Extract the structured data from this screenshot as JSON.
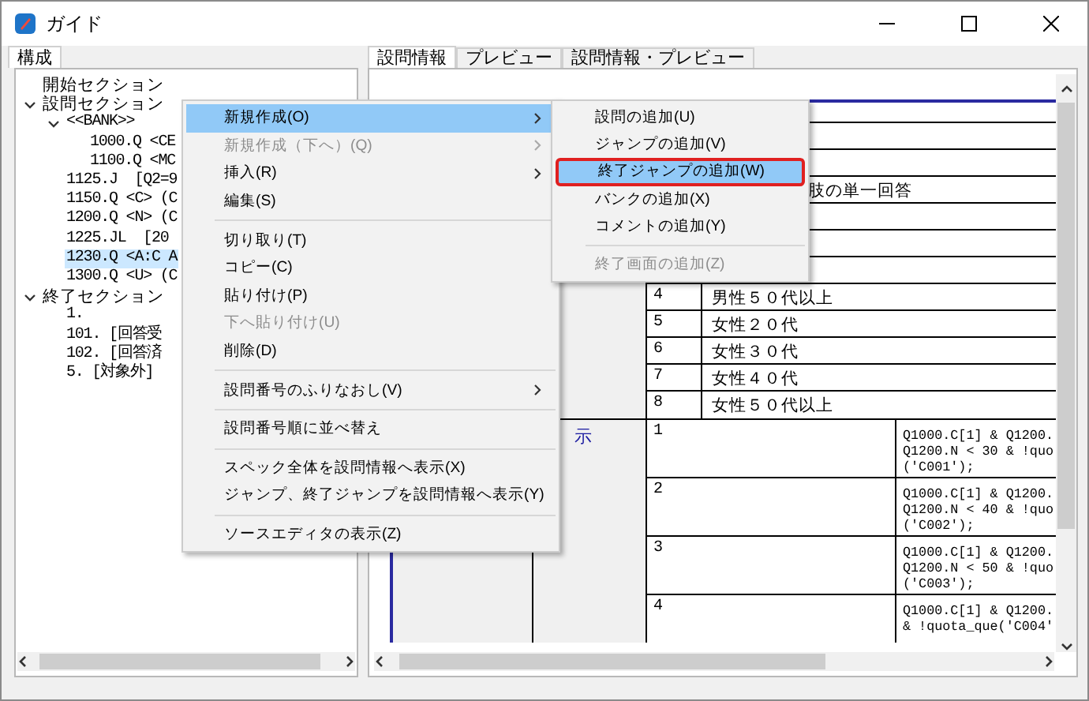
{
  "window": {
    "title": "ガイド"
  },
  "left_tabs": [
    {
      "label": "構成",
      "selected": true
    }
  ],
  "tree": [
    {
      "label": "開始セクション",
      "selected": false
    },
    {
      "label": "設問セクション",
      "expanded": true,
      "selected": false,
      "children": [
        {
          "label": "<<BANK>>",
          "expanded": true,
          "selected": false,
          "children": [
            {
              "label": "1000.Q <CE",
              "selected": false
            },
            {
              "label": "1100.Q <MC",
              "selected": false
            }
          ]
        },
        {
          "label": "1125.J  [Q2=9",
          "selected": false
        },
        {
          "label": "1150.Q <C> (C",
          "selected": false
        },
        {
          "label": "1200.Q <N> (C",
          "selected": false
        },
        {
          "label": "1225.JL  [20",
          "selected": false
        },
        {
          "label": "1230.Q <A:C A",
          "selected": true
        },
        {
          "label": "1300.Q <U> (C",
          "selected": false
        }
      ]
    },
    {
      "label": "終了セクション",
      "expanded": true,
      "selected": false,
      "children": [
        {
          "label": "1.",
          "selected": false
        },
        {
          "label": "101. [回答受",
          "selected": false
        },
        {
          "label": "102. [回答済",
          "selected": false
        },
        {
          "label": "5. [対象外]",
          "selected": false
        }
      ]
    }
  ],
  "right_tabs": [
    {
      "label": "設問情報",
      "selected": true
    },
    {
      "label": "プレビュー",
      "selected": false
    },
    {
      "label": "設問情報・プレビュー",
      "selected": false
    }
  ],
  "question_table": {
    "description_fragment": "肢の単一回答",
    "choices": [
      {
        "number": "4",
        "text": "男性５０代以上"
      },
      {
        "number": "5",
        "text": "女性２０代"
      },
      {
        "number": "6",
        "text": "女性３０代"
      },
      {
        "number": "7",
        "text": "女性４０代"
      },
      {
        "number": "8",
        "text": "女性５０代以上"
      }
    ],
    "condition_label": "示",
    "conditions": [
      {
        "number": "1",
        "code": "Q1000.C[1] & Q1200.\nQ1200.N < 30 & !quo\n('C001');"
      },
      {
        "number": "2",
        "code": "Q1000.C[1] & Q1200.\nQ1200.N < 40 & !quo\n('C002');"
      },
      {
        "number": "3",
        "code": "Q1000.C[1] & Q1200.\nQ1200.N < 50 & !quo\n('C003');"
      },
      {
        "number": "4",
        "code": "Q1000.C[1] & Q1200.\n& !quota_que('C004'"
      }
    ]
  },
  "context_menu": [
    {
      "kind": "item",
      "label": "新規作成(O)",
      "submenu": true,
      "disabled": false,
      "selected": true
    },
    {
      "kind": "item",
      "label": "新規作成（下へ）(Q)",
      "submenu": true,
      "disabled": true,
      "selected": false
    },
    {
      "kind": "item",
      "label": "挿入(R)",
      "submenu": true,
      "disabled": false,
      "selected": false
    },
    {
      "kind": "item",
      "label": "編集(S)",
      "submenu": false,
      "disabled": false,
      "selected": false
    },
    {
      "kind": "separator"
    },
    {
      "kind": "item",
      "label": "切り取り(T)",
      "submenu": false,
      "disabled": false,
      "selected": false
    },
    {
      "kind": "item",
      "label": "コピー(C)",
      "submenu": false,
      "disabled": false,
      "selected": false
    },
    {
      "kind": "item",
      "label": "貼り付け(P)",
      "submenu": false,
      "disabled": false,
      "selected": false
    },
    {
      "kind": "item",
      "label": "下へ貼り付け(U)",
      "submenu": false,
      "disabled": true,
      "selected": false
    },
    {
      "kind": "item",
      "label": "削除(D)",
      "submenu": false,
      "disabled": false,
      "selected": false
    },
    {
      "kind": "separator"
    },
    {
      "kind": "item",
      "label": "設問番号のふりなおし(V)",
      "submenu": true,
      "disabled": false,
      "selected": false
    },
    {
      "kind": "separator"
    },
    {
      "kind": "item",
      "label": "設問番号順に並べ替え",
      "submenu": false,
      "disabled": false,
      "selected": false
    },
    {
      "kind": "separator"
    },
    {
      "kind": "item",
      "label": "スペック全体を設問情報へ表示(X)",
      "submenu": false,
      "disabled": false,
      "selected": false
    },
    {
      "kind": "item",
      "label": "ジャンプ、終了ジャンプを設問情報へ表示(Y)",
      "submenu": false,
      "disabled": false,
      "selected": false
    },
    {
      "kind": "separator"
    },
    {
      "kind": "item",
      "label": "ソースエディタの表示(Z)",
      "submenu": false,
      "disabled": false,
      "selected": false
    }
  ],
  "submenu": [
    {
      "kind": "item",
      "label": "設問の追加(U)",
      "disabled": false,
      "selected": false,
      "outlined": false
    },
    {
      "kind": "item",
      "label": "ジャンプの追加(V)",
      "disabled": false,
      "selected": false,
      "outlined": false
    },
    {
      "kind": "item",
      "label": "終了ジャンプの追加(W)",
      "disabled": false,
      "selected": true,
      "outlined": true
    },
    {
      "kind": "item",
      "label": "バンクの追加(X)",
      "disabled": false,
      "selected": false,
      "outlined": false
    },
    {
      "kind": "item",
      "label": "コメントの追加(Y)",
      "disabled": false,
      "selected": false,
      "outlined": false
    },
    {
      "kind": "separator"
    },
    {
      "kind": "item",
      "label": "終了画面の追加(Z)",
      "disabled": true,
      "selected": false,
      "outlined": false
    }
  ]
}
